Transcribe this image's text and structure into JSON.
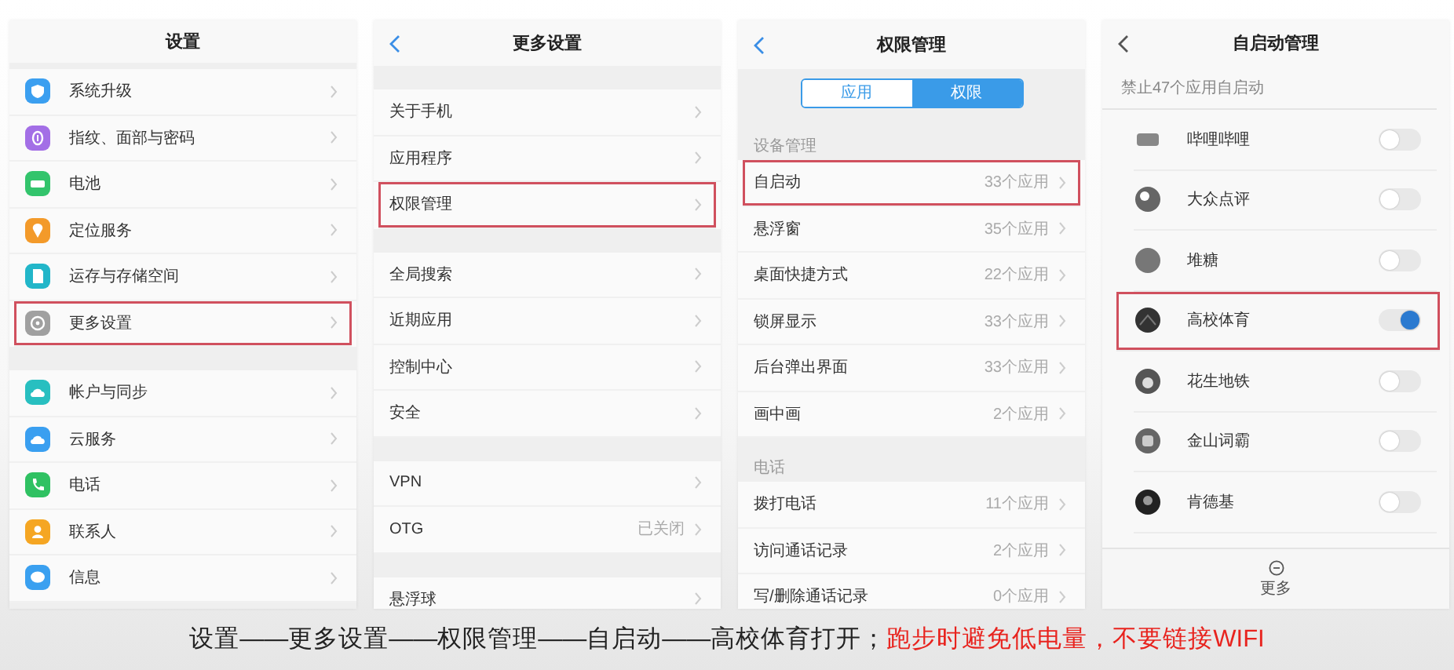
{
  "screens": [
    {
      "kind": "settings",
      "title": "设置",
      "back": false,
      "groups": [
        {
          "items": [
            {
              "label": "系统升级",
              "color": "#3b9ff0",
              "highlighted": false
            },
            {
              "label": "指纹、面部与密码",
              "color": "#a36fe6",
              "highlighted": false
            },
            {
              "label": "电池",
              "color": "#33c46c",
              "highlighted": false
            },
            {
              "label": "定位服务",
              "color": "#f39a2a",
              "highlighted": false
            },
            {
              "label": "运存与存储空间",
              "color": "#22b6c9",
              "highlighted": false
            },
            {
              "label": "更多设置",
              "color": "#a0a0a0",
              "highlighted": true
            }
          ]
        },
        {
          "items": [
            {
              "label": "帐户与同步",
              "color": "#28bfc0",
              "highlighted": false
            },
            {
              "label": "云服务",
              "color": "#3a9ff0",
              "highlighted": false
            },
            {
              "label": "电话",
              "color": "#2fc162",
              "highlighted": false
            },
            {
              "label": "联系人",
              "color": "#f5a623",
              "highlighted": false
            },
            {
              "label": "信息",
              "color": "#3aa0f0",
              "highlighted": false
            }
          ]
        }
      ]
    },
    {
      "kind": "settings",
      "title": "更多设置",
      "back": true,
      "groups": [
        {
          "items": [
            {
              "label": "关于手机",
              "highlighted": false
            },
            {
              "label": "应用程序",
              "highlighted": false
            },
            {
              "label": "权限管理",
              "highlighted": true
            }
          ]
        },
        {
          "items": [
            {
              "label": "全局搜索",
              "highlighted": false
            },
            {
              "label": "近期应用",
              "highlighted": false
            },
            {
              "label": "控制中心",
              "highlighted": false
            },
            {
              "label": "安全",
              "highlighted": false
            }
          ]
        },
        {
          "items": [
            {
              "label": "VPN",
              "highlighted": false
            },
            {
              "label": "OTG",
              "value": "已关闭",
              "highlighted": false
            }
          ]
        },
        {
          "items": [
            {
              "label": "悬浮球",
              "highlighted": false
            }
          ]
        }
      ]
    },
    {
      "kind": "permissions",
      "title": "权限管理",
      "back": true,
      "tabs": [
        {
          "label": "应用",
          "selected": false
        },
        {
          "label": "权限",
          "selected": true
        }
      ],
      "sections": [
        {
          "heading": "设备管理",
          "items": [
            {
              "label": "自启动",
              "value": "33个应用",
              "highlighted": true
            },
            {
              "label": "悬浮窗",
              "value": "35个应用",
              "highlighted": false
            },
            {
              "label": "桌面快捷方式",
              "value": "22个应用",
              "highlighted": false
            },
            {
              "label": "锁屏显示",
              "value": "33个应用",
              "highlighted": false
            },
            {
              "label": "后台弹出界面",
              "value": "33个应用",
              "highlighted": false
            },
            {
              "label": "画中画",
              "value": "2个应用",
              "highlighted": false
            }
          ]
        },
        {
          "heading": "电话",
          "items": [
            {
              "label": "拨打电话",
              "value": "11个应用",
              "highlighted": false
            },
            {
              "label": "访问通话记录",
              "value": "2个应用",
              "highlighted": false
            },
            {
              "label": "写/删除通话记录",
              "value": "0个应用",
              "highlighted": false
            }
          ]
        }
      ]
    },
    {
      "kind": "autostart",
      "title": "自启动管理",
      "back": true,
      "subtitle": "禁止47个应用自启动",
      "apps": [
        {
          "name": "哔哩哔哩",
          "on": false,
          "highlighted": false
        },
        {
          "name": "大众点评",
          "on": false,
          "highlighted": false
        },
        {
          "name": "堆糖",
          "on": false,
          "highlighted": false
        },
        {
          "name": "高校体育",
          "on": true,
          "highlighted": true
        },
        {
          "name": "花生地铁",
          "on": false,
          "highlighted": false
        },
        {
          "name": "金山词霸",
          "on": false,
          "highlighted": false
        },
        {
          "name": "肯德基",
          "on": false,
          "highlighted": false
        }
      ],
      "footer": "更多"
    }
  ],
  "caption": {
    "steps": "设置——更多设置——权限管理——自启动——高校体育打开；",
    "note": "跑步时避免低电量，不要链接WIFI"
  }
}
